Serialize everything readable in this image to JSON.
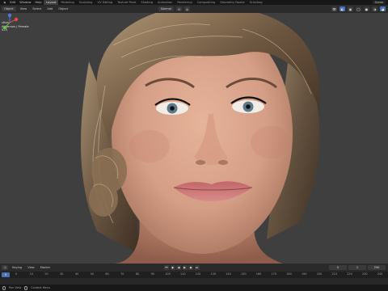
{
  "topbar": {
    "menus": [
      "Edit",
      "Window",
      "Help"
    ],
    "workspaces": [
      "Layout",
      "Modeling",
      "Sculpting",
      "UV Editing",
      "Texture Paint",
      "Shading",
      "Animation",
      "Rendering",
      "Compositing",
      "Geometry Nodes",
      "Scripting"
    ],
    "active_workspace": "Layout",
    "scene": "Scene"
  },
  "viewport_header": {
    "mode": "Object",
    "menus": [
      "View",
      "Select",
      "Add",
      "Object"
    ],
    "orientation": "Normal",
    "row2": {
      "orientation": "Normal",
      "snap": "Drag",
      "select": "Select Box"
    }
  },
  "overlay": {
    "line1": "ctive",
    "line2": "Anderson | Female",
    "line3": "024"
  },
  "timeline": {
    "menus": [
      "Keying",
      "View",
      "Marker"
    ],
    "current_frame": "0",
    "start_label": "1",
    "end_label": "250",
    "ticks": [
      "0",
      "10",
      "20",
      "30",
      "40",
      "50",
      "60",
      "70",
      "80",
      "90",
      "100",
      "110",
      "120",
      "130",
      "140",
      "150",
      "160",
      "170",
      "180",
      "190",
      "200",
      "210",
      "220",
      "230",
      "240"
    ]
  },
  "statusbar": {
    "items": [
      "Pan View",
      "Context Menu"
    ]
  },
  "colors": {
    "accent": "#4772b3",
    "viewport_bg": "#3f3f3f",
    "header_bg": "#2b2b2b"
  }
}
